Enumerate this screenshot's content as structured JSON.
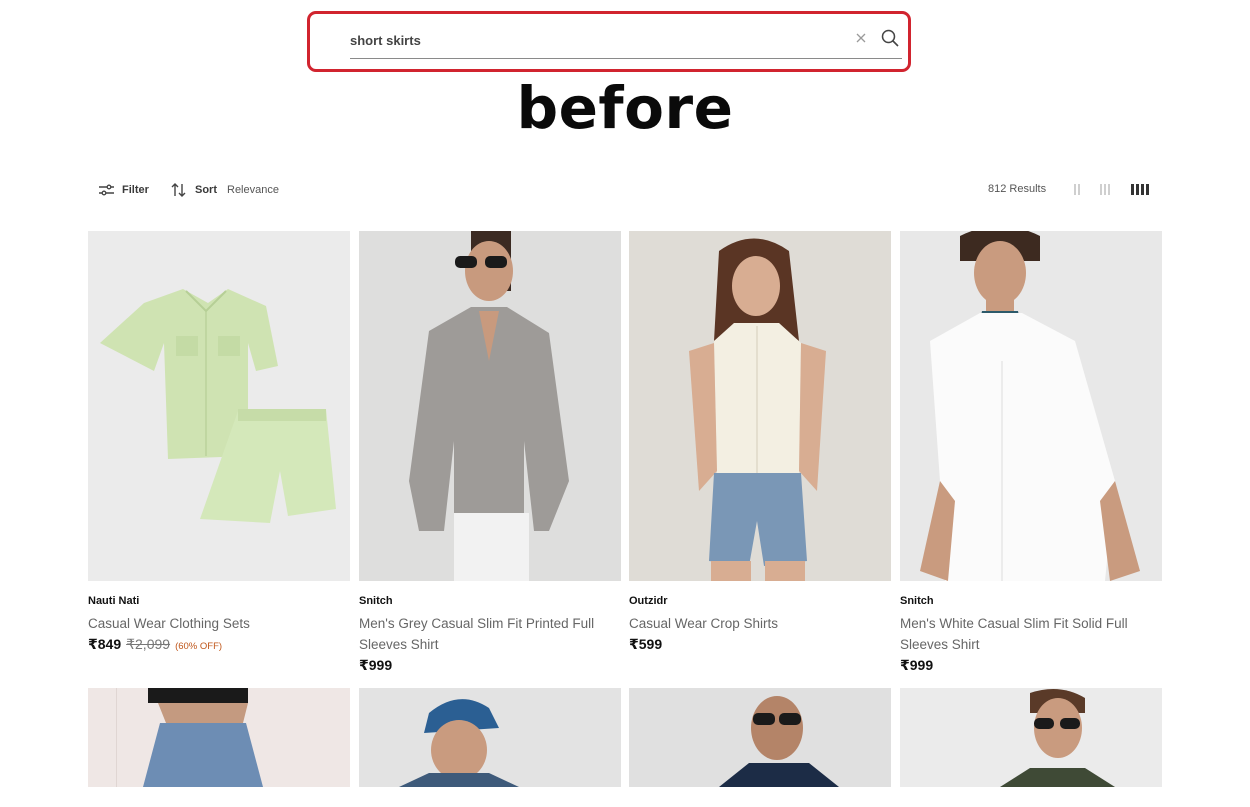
{
  "search": {
    "value": "short skirts",
    "placeholder": "",
    "clear_icon": "close-icon",
    "submit_icon": "search-icon"
  },
  "annotation_text": "before",
  "toolbar": {
    "filter_label": "Filter",
    "sort_label": "Sort",
    "sort_value": "Relevance",
    "results_text": "812 Results",
    "active_view": "4-column"
  },
  "products": [
    {
      "brand": "Nauti Nati",
      "title": "Casual Wear Clothing Sets",
      "price": "₹849",
      "mrp": "₹2,099",
      "discount": "(60% OFF)"
    },
    {
      "brand": "Snitch",
      "title": "Men's Grey Casual Slim Fit Printed Full Sleeves Shirt",
      "price": "₹999",
      "mrp": "",
      "discount": ""
    },
    {
      "brand": "Outzidr",
      "title": "Casual Wear Crop Shirts",
      "price": "₹599",
      "mrp": "",
      "discount": ""
    },
    {
      "brand": "Snitch",
      "title": "Men's White Casual Slim Fit Solid Full Sleeves Shirt",
      "price": "₹999",
      "mrp": "",
      "discount": ""
    }
  ],
  "colors": {
    "highlight_border": "#d1242f",
    "discount": "#c0571b",
    "text_primary": "#111111",
    "text_secondary": "#666666"
  }
}
